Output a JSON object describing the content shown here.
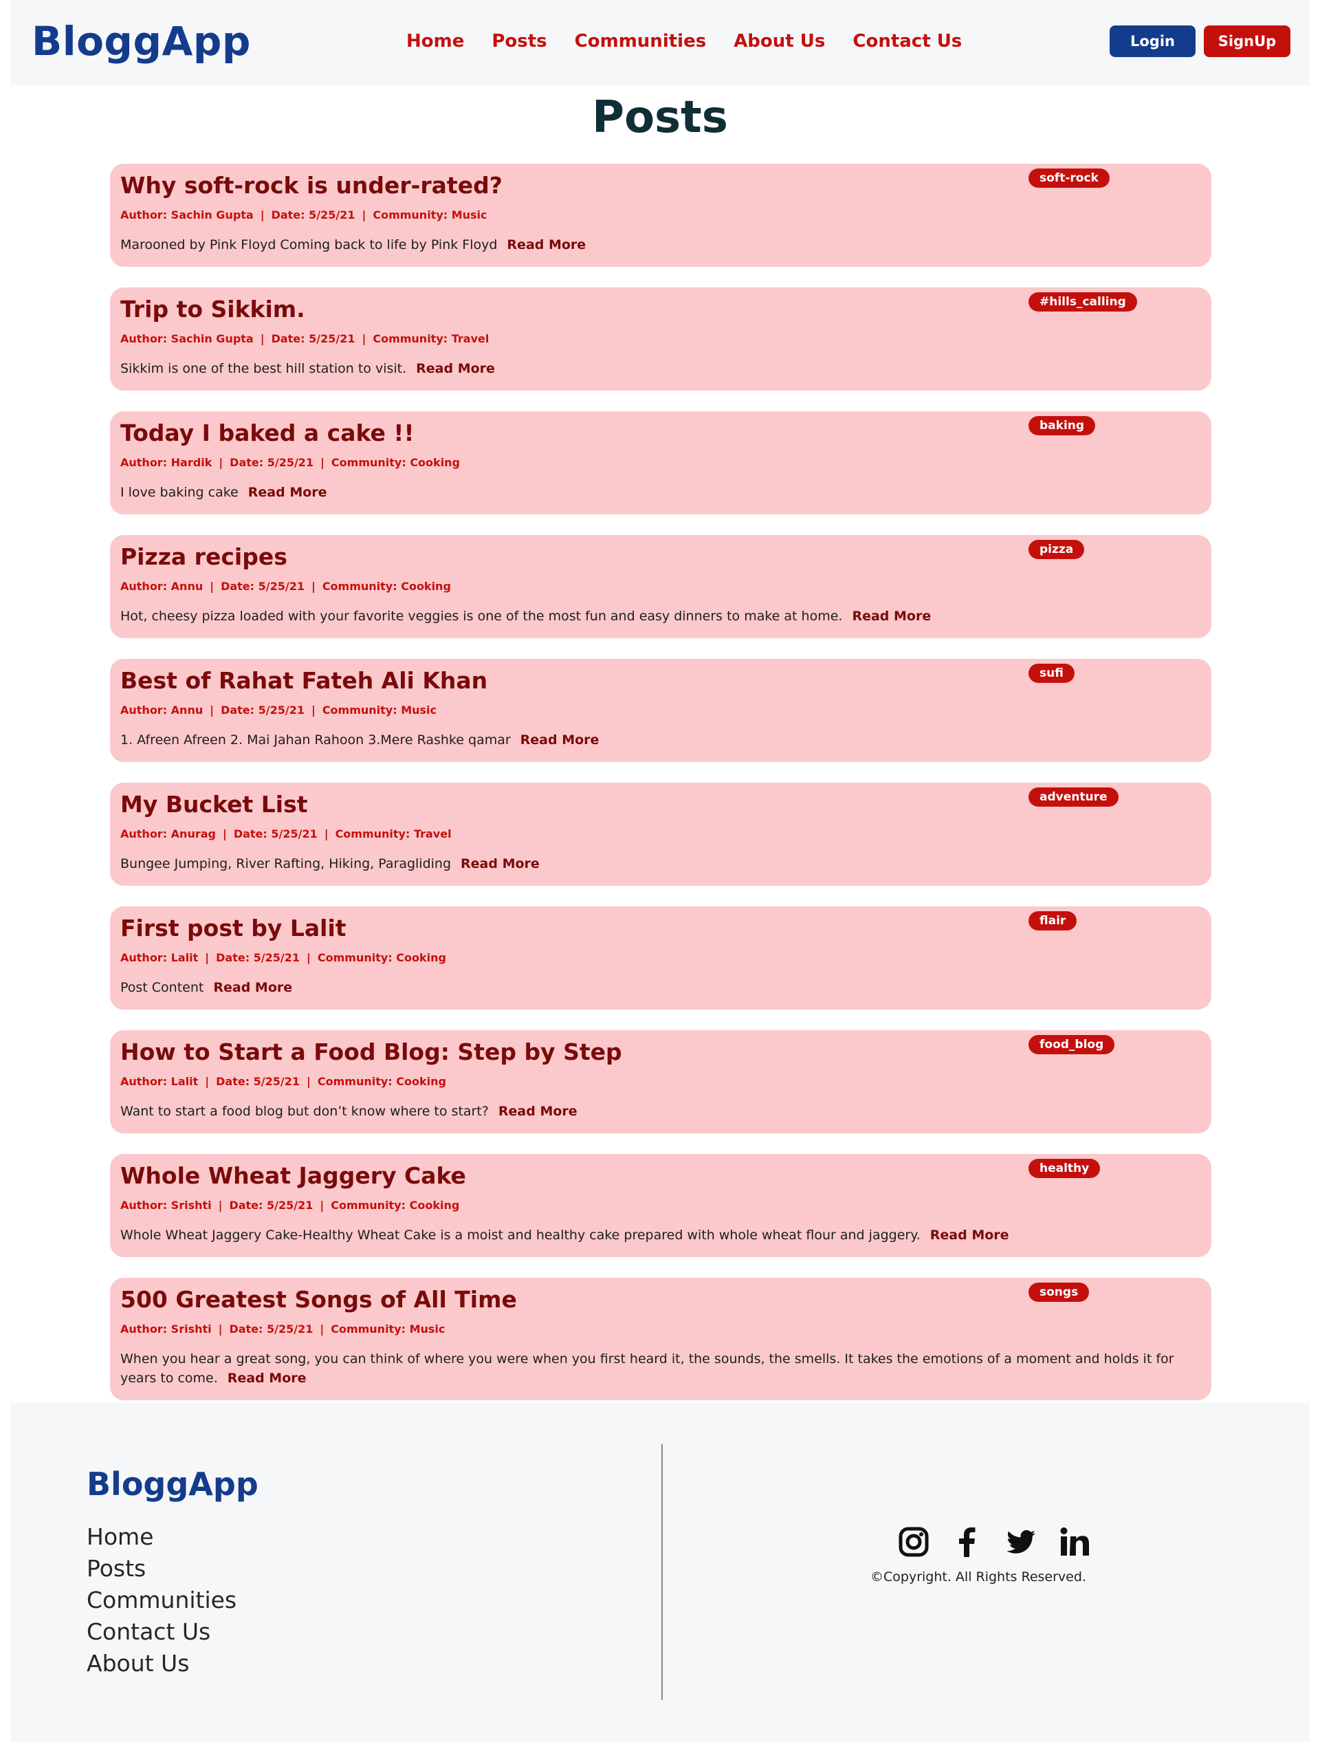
{
  "header": {
    "brand": "BloggApp",
    "nav": [
      "Home",
      "Posts",
      "Communities",
      "About Us",
      "Contact Us"
    ],
    "login_label": "Login",
    "signup_label": "SignUp"
  },
  "page_title": "Posts",
  "read_more_label": "Read More",
  "posts": [
    {
      "title": "Why soft-rock is under-rated?",
      "author": "Author: Sachin Gupta",
      "date": "Date: 5/25/21",
      "community": "Community: Music",
      "body": "Marooned by Pink Floyd Coming back to life by Pink Floyd",
      "tag": "soft-rock"
    },
    {
      "title": "Trip to Sikkim.",
      "author": "Author: Sachin Gupta",
      "date": "Date: 5/25/21",
      "community": "Community: Travel",
      "body": "Sikkim is one of the best hill station to visit.",
      "tag": "#hills_calling"
    },
    {
      "title": "Today I baked a cake !!",
      "author": "Author: Hardik",
      "date": "Date: 5/25/21",
      "community": "Community: Cooking",
      "body": "I love baking cake",
      "tag": "baking"
    },
    {
      "title": "Pizza recipes",
      "author": "Author: Annu",
      "date": "Date: 5/25/21",
      "community": "Community: Cooking",
      "body": "Hot, cheesy pizza loaded with your favorite veggies is one of the most fun and easy dinners to make at home.",
      "tag": "pizza"
    },
    {
      "title": "Best of Rahat Fateh Ali Khan",
      "author": "Author: Annu",
      "date": "Date: 5/25/21",
      "community": "Community: Music",
      "body": "1. Afreen Afreen 2. Mai Jahan Rahoon 3.Mere Rashke qamar",
      "tag": "sufi"
    },
    {
      "title": "My Bucket List",
      "author": "Author: Anurag",
      "date": "Date: 5/25/21",
      "community": "Community: Travel",
      "body": "Bungee Jumping, River Rafting, Hiking, Paragliding",
      "tag": "adventure"
    },
    {
      "title": "First post by Lalit",
      "author": "Author: Lalit",
      "date": "Date: 5/25/21",
      "community": "Community: Cooking",
      "body": "Post Content",
      "tag": "flair"
    },
    {
      "title": "How to Start a Food Blog: Step by Step",
      "author": "Author: Lalit",
      "date": "Date: 5/25/21",
      "community": "Community: Cooking",
      "body": "Want to start a food blog but don’t know where to start?",
      "tag": "food_blog"
    },
    {
      "title": "Whole Wheat Jaggery Cake",
      "author": "Author: Srishti",
      "date": "Date: 5/25/21",
      "community": "Community: Cooking",
      "body": "Whole Wheat Jaggery Cake-Healthy Wheat Cake is a moist and healthy cake prepared with whole wheat flour and jaggery.",
      "tag": "healthy"
    },
    {
      "title": "500 Greatest Songs of All Time",
      "author": "Author: Srishti",
      "date": "Date: 5/25/21",
      "community": "Community: Music",
      "body": "When you hear a great song, you can think of where you were when you first heard it, the sounds, the smells. It takes the emotions of a moment and holds it for years to come.",
      "tag": "songs"
    }
  ],
  "footer": {
    "brand": "BloggApp",
    "links": [
      "Home",
      "Posts",
      "Communities",
      "Contact Us",
      "About Us"
    ],
    "social_icons": [
      "instagram-icon",
      "facebook-icon",
      "twitter-icon",
      "linkedin-icon"
    ],
    "copyright": "©Copyright. All Rights Reserved."
  },
  "colors": {
    "brand_blue": "#143c8c",
    "accent_red": "#c4100d",
    "post_bg": "#fbc9cb",
    "post_title": "#7a0a0a"
  }
}
